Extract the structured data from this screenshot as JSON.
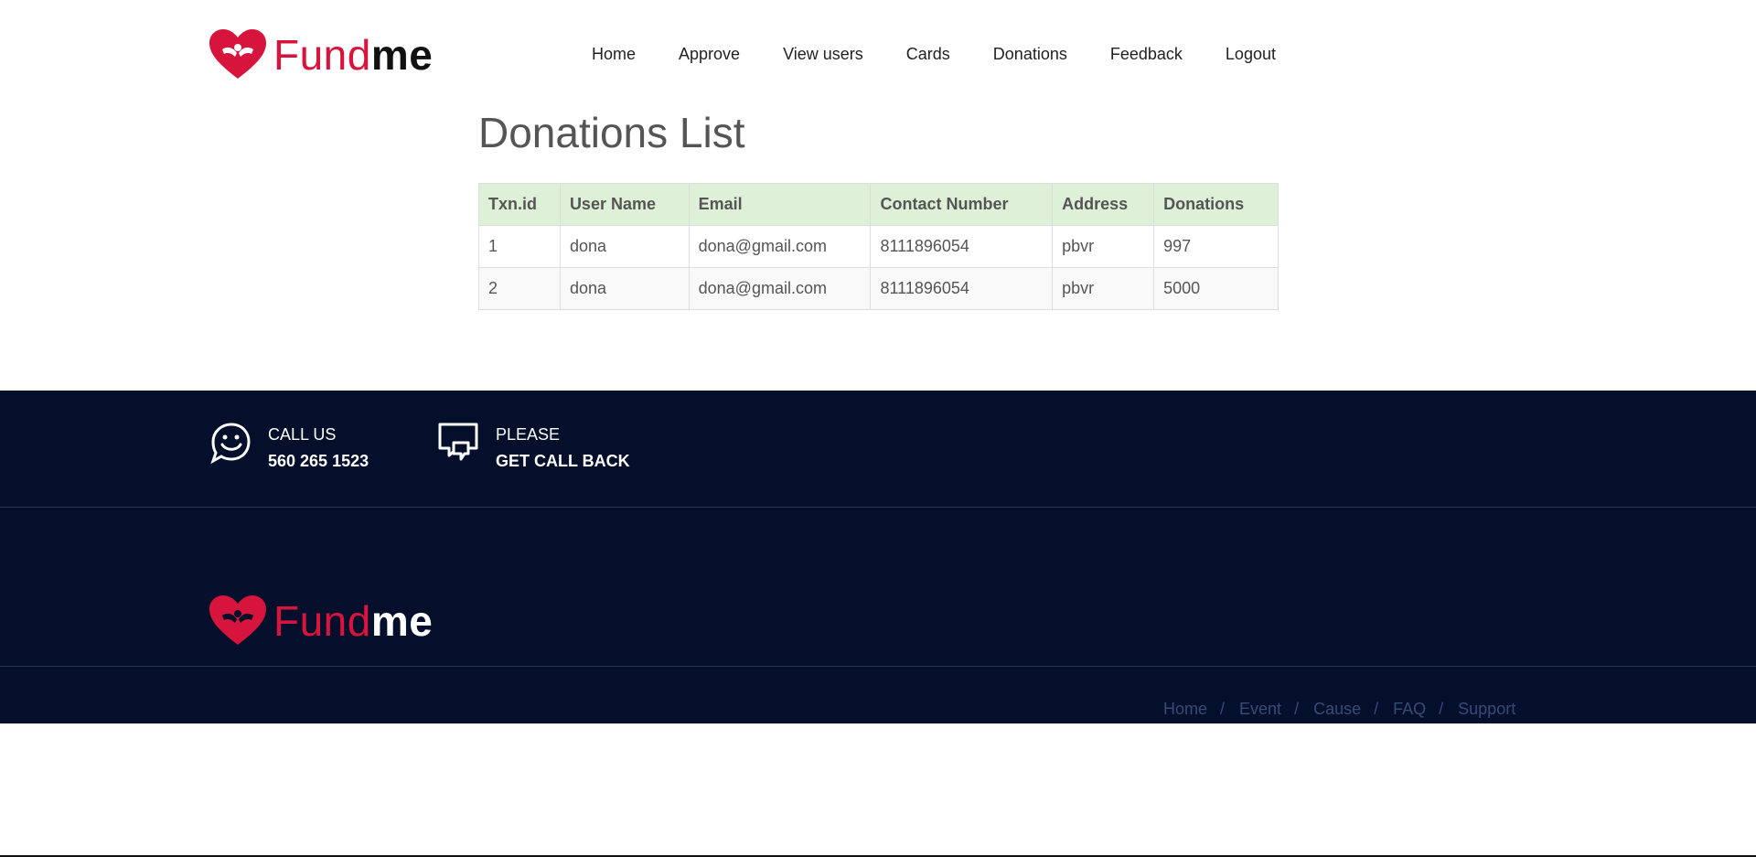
{
  "brand": {
    "fund": "Fund",
    "me": "me"
  },
  "nav": {
    "items": [
      "Home",
      "Approve",
      "View users",
      "Cards",
      "Donations",
      "Feedback",
      "Logout"
    ]
  },
  "page": {
    "title": "Donations List"
  },
  "table": {
    "headers": [
      "Txn.id",
      "User Name",
      "Email",
      "Contact Number",
      "Address",
      "Donations"
    ],
    "rows": [
      [
        "1",
        "dona",
        "dona@gmail.com",
        "8111896054",
        "pbvr",
        "997"
      ],
      [
        "2",
        "dona",
        "dona@gmail.com",
        "8111896054",
        "pbvr",
        "5000"
      ]
    ]
  },
  "footer": {
    "call_label": "CALL US",
    "call_number": "560 265 1523",
    "callback_line1": "PLEASE",
    "callback_line2": "GET CALL BACK",
    "links": [
      "Home",
      "Event",
      "Cause",
      "FAQ",
      "Support"
    ],
    "separator": "/"
  },
  "colors": {
    "brand_red": "#d7143c",
    "footer_bg": "#040f2b",
    "table_header_bg": "#dff0d8",
    "footer_link": "#3a4a78"
  },
  "icons": {
    "logo": "heart-hands-icon",
    "call": "smiley-chat-icon",
    "callback": "chat-bubbles-icon"
  }
}
